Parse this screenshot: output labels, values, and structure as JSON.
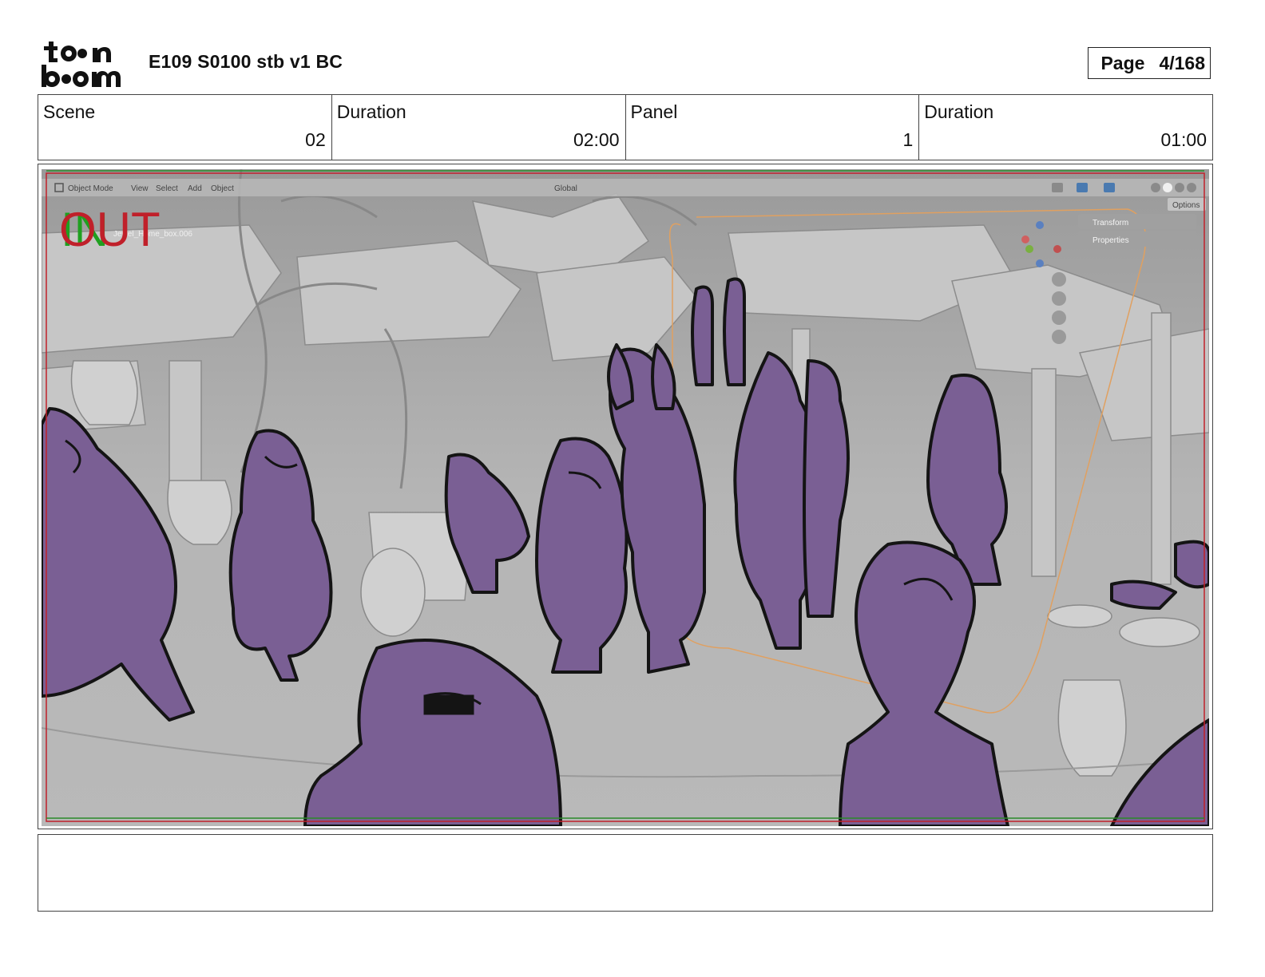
{
  "header": {
    "logo_text": "toon boom",
    "title": "E109 S0100 stb v1 BC",
    "page_label": "Page",
    "page_value": "4/168"
  },
  "info": [
    {
      "label": "Scene",
      "value": "02"
    },
    {
      "label": "Duration",
      "value": "02:00"
    },
    {
      "label": "Panel",
      "value": "1"
    },
    {
      "label": "Duration",
      "value": "01:00"
    }
  ],
  "viewport": {
    "mode": "Object Mode",
    "menu": [
      "View",
      "Select",
      "Add",
      "Object"
    ],
    "transform_orientation": "Global",
    "options_label": "Options",
    "sidebar": [
      "Transform",
      "Properties"
    ],
    "overlay_in": "IN",
    "overlay_out": "OUT",
    "object_name": "Jewel_Home_box.006"
  },
  "notes": "",
  "colors": {
    "character_fill": "#7a5f94",
    "viewport_bg": "#a9a9a9",
    "safe_frame_red": "#c0202a",
    "safe_frame_green": "#2a8a2a",
    "out_text": "#c0202a",
    "in_text": "#1fa020"
  }
}
